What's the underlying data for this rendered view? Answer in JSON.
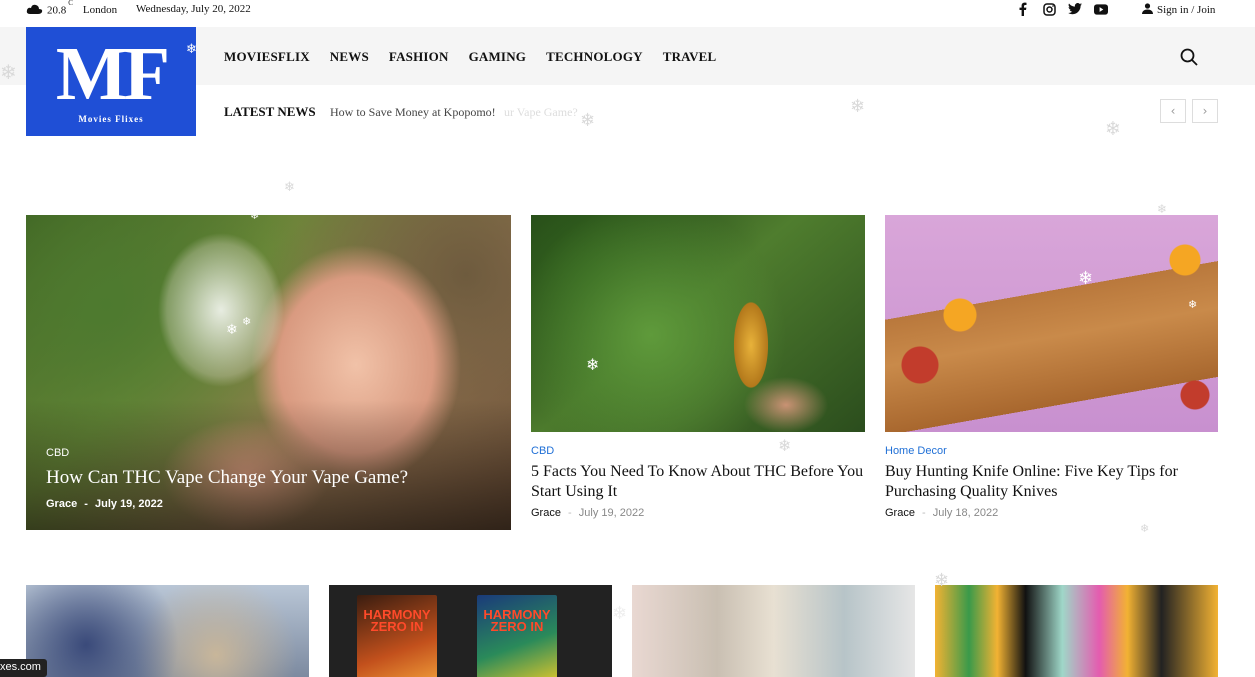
{
  "topbar": {
    "temperature": "20.8",
    "unit": "C",
    "city": "London",
    "date": "Wednesday, July 20, 2022",
    "social_icons": [
      "facebook-icon",
      "instagram-icon",
      "twitter-icon",
      "youtube-icon"
    ],
    "signin_label": "Sign in / Join"
  },
  "logo": {
    "mark": "MF",
    "subtitle": "Movies Flixes",
    "color": "#1f4fd6"
  },
  "nav": {
    "items": [
      "MOVIESFLIX",
      "NEWS",
      "FASHION",
      "GAMING",
      "TECHNOLOGY",
      "TRAVEL"
    ]
  },
  "latest_news": {
    "label": "LATEST NEWS",
    "headline": "How to Save Money at Kpopomo!",
    "ghost_text": "ur Vape Game?",
    "prev_arrow": "‹",
    "next_arrow": "›"
  },
  "featured": [
    {
      "category": "CBD",
      "title": "How Can THC Vape Change Your Vape Game?",
      "author": "Grace",
      "separator": "-",
      "date": "July 19, 2022"
    },
    {
      "category": "CBD",
      "title": "5 Facts You Need To Know About THC Before You Start Using It",
      "author": "Grace",
      "separator": "-",
      "date": "July 19, 2022"
    },
    {
      "category": "Home Decor",
      "title": "Buy Hunting Knife Online: Five Key Tips for Purchasing Quality Knives",
      "author": "Grace",
      "separator": "-",
      "date": "July 18, 2022"
    }
  ],
  "bottom_row": {
    "book_title_1": "HARMONY ZERO IN",
    "book_title_2": "HARMONY ZERO IN"
  },
  "domain_badge": "xes.com",
  "colors": {
    "category_link": "#1f6fd6",
    "header_band": "#f5f5f5"
  }
}
